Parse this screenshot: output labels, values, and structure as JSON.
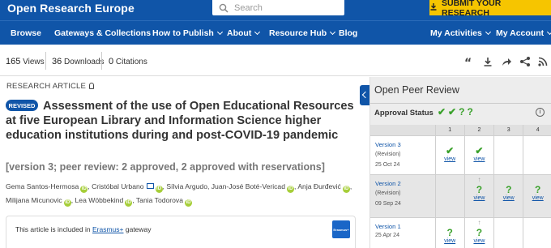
{
  "header": {
    "brand": "Open Research Europe",
    "search_placeholder": "Search",
    "submit_label": "SUBMIT YOUR RESEARCH"
  },
  "nav": {
    "items": [
      "Browse",
      "Gateways & Collections",
      "How to Publish",
      "About",
      "Resource Hub",
      "Blog"
    ],
    "right_items": [
      "My Activities",
      "My Account"
    ]
  },
  "metrics": {
    "views_count": "165",
    "views_label": "Views",
    "downloads_count": "36",
    "downloads_label": "Downloads",
    "citations_count": "0",
    "citations_label": "Citations"
  },
  "article": {
    "type": "RESEARCH ARTICLE",
    "badge": "REVISED",
    "title": "Assessment of the use of Open Educational Resources at five European Library and Information Science higher education institutions during and post-COVID-19 pandemic",
    "version": "[version 3; peer review: 2 approved, 2 approved with reservations]",
    "authors_line1": [
      "Gema Santos-Hermosa",
      "Cristóbal Urbano",
      "Sílvia Argudo",
      "Juan-José Boté-Vericad",
      "Anja Đurđević"
    ],
    "authors_line2": [
      "Milijana Micunovic",
      "Lea Wöbbekind",
      "Tania Todorova"
    ],
    "gateway_text": "This article is included in",
    "gateway_link": "Erasmus+",
    "gateway_suffix": "gateway",
    "gateway_logo_text": "Erasmus+"
  },
  "peer_review": {
    "title": "Open Peer Review",
    "status_label": "Approval Status",
    "status_marks": "✔✔??",
    "info": "i",
    "columns": [
      "1",
      "2",
      "3",
      "4"
    ],
    "rows": [
      {
        "version": "Version 3",
        "note": "(Revision)",
        "date": "25 Oct 24",
        "cells": [
          {
            "mark": "✔",
            "view": "view"
          },
          {
            "mark": "✔",
            "view": "view"
          },
          {
            "mark": "",
            "view": ""
          },
          {
            "mark": "",
            "view": ""
          }
        ]
      },
      {
        "version": "Version 2",
        "note": "(Revision)",
        "date": "09 Sep 24",
        "cells": [
          {
            "mark": "",
            "view": ""
          },
          {
            "mark": "?",
            "view": "view",
            "arrow": "↑"
          },
          {
            "mark": "?",
            "view": "view"
          },
          {
            "mark": "?",
            "view": "view"
          }
        ]
      },
      {
        "version": "Version 1",
        "note": "",
        "date": "25 Apr 24",
        "cells": [
          {
            "mark": "?",
            "view": "view"
          },
          {
            "mark": "?",
            "view": "view",
            "arrow": "↑"
          },
          {
            "mark": "",
            "view": ""
          },
          {
            "mark": "",
            "view": ""
          }
        ]
      }
    ]
  },
  "colors": {
    "brand_blue": "#1055a8",
    "accent_yellow": "#f6c500",
    "approve_green": "#3aa12b"
  }
}
